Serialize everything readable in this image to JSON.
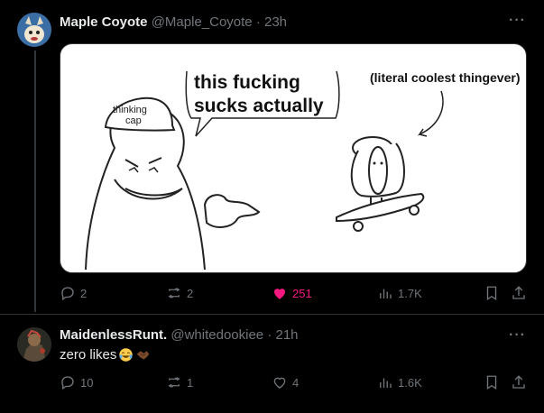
{
  "post1": {
    "display_name": "Maple Coyote",
    "handle": "@Maple_Coyote",
    "dot": "·",
    "time": "23h",
    "more": "···",
    "image": {
      "hat_label_1": "thinking",
      "hat_label_2": "cap",
      "speech_line_1": "this fucking",
      "speech_line_2": "sucks actually",
      "caption": "(literal coolest thingever)"
    },
    "actions": {
      "replies": "2",
      "reposts": "2",
      "likes": "251",
      "views": "1.7K"
    }
  },
  "post2": {
    "display_name": "MaidenlessRunt.",
    "handle": "@whitedookiee",
    "dot": "·",
    "time": "21h",
    "more": "···",
    "text": "zero likes",
    "actions": {
      "replies": "10",
      "reposts": "1",
      "likes": "4",
      "views": "1.6K"
    }
  },
  "colors": {
    "background": "#000000",
    "muted": "#71767b",
    "like_active": "#f91880"
  }
}
